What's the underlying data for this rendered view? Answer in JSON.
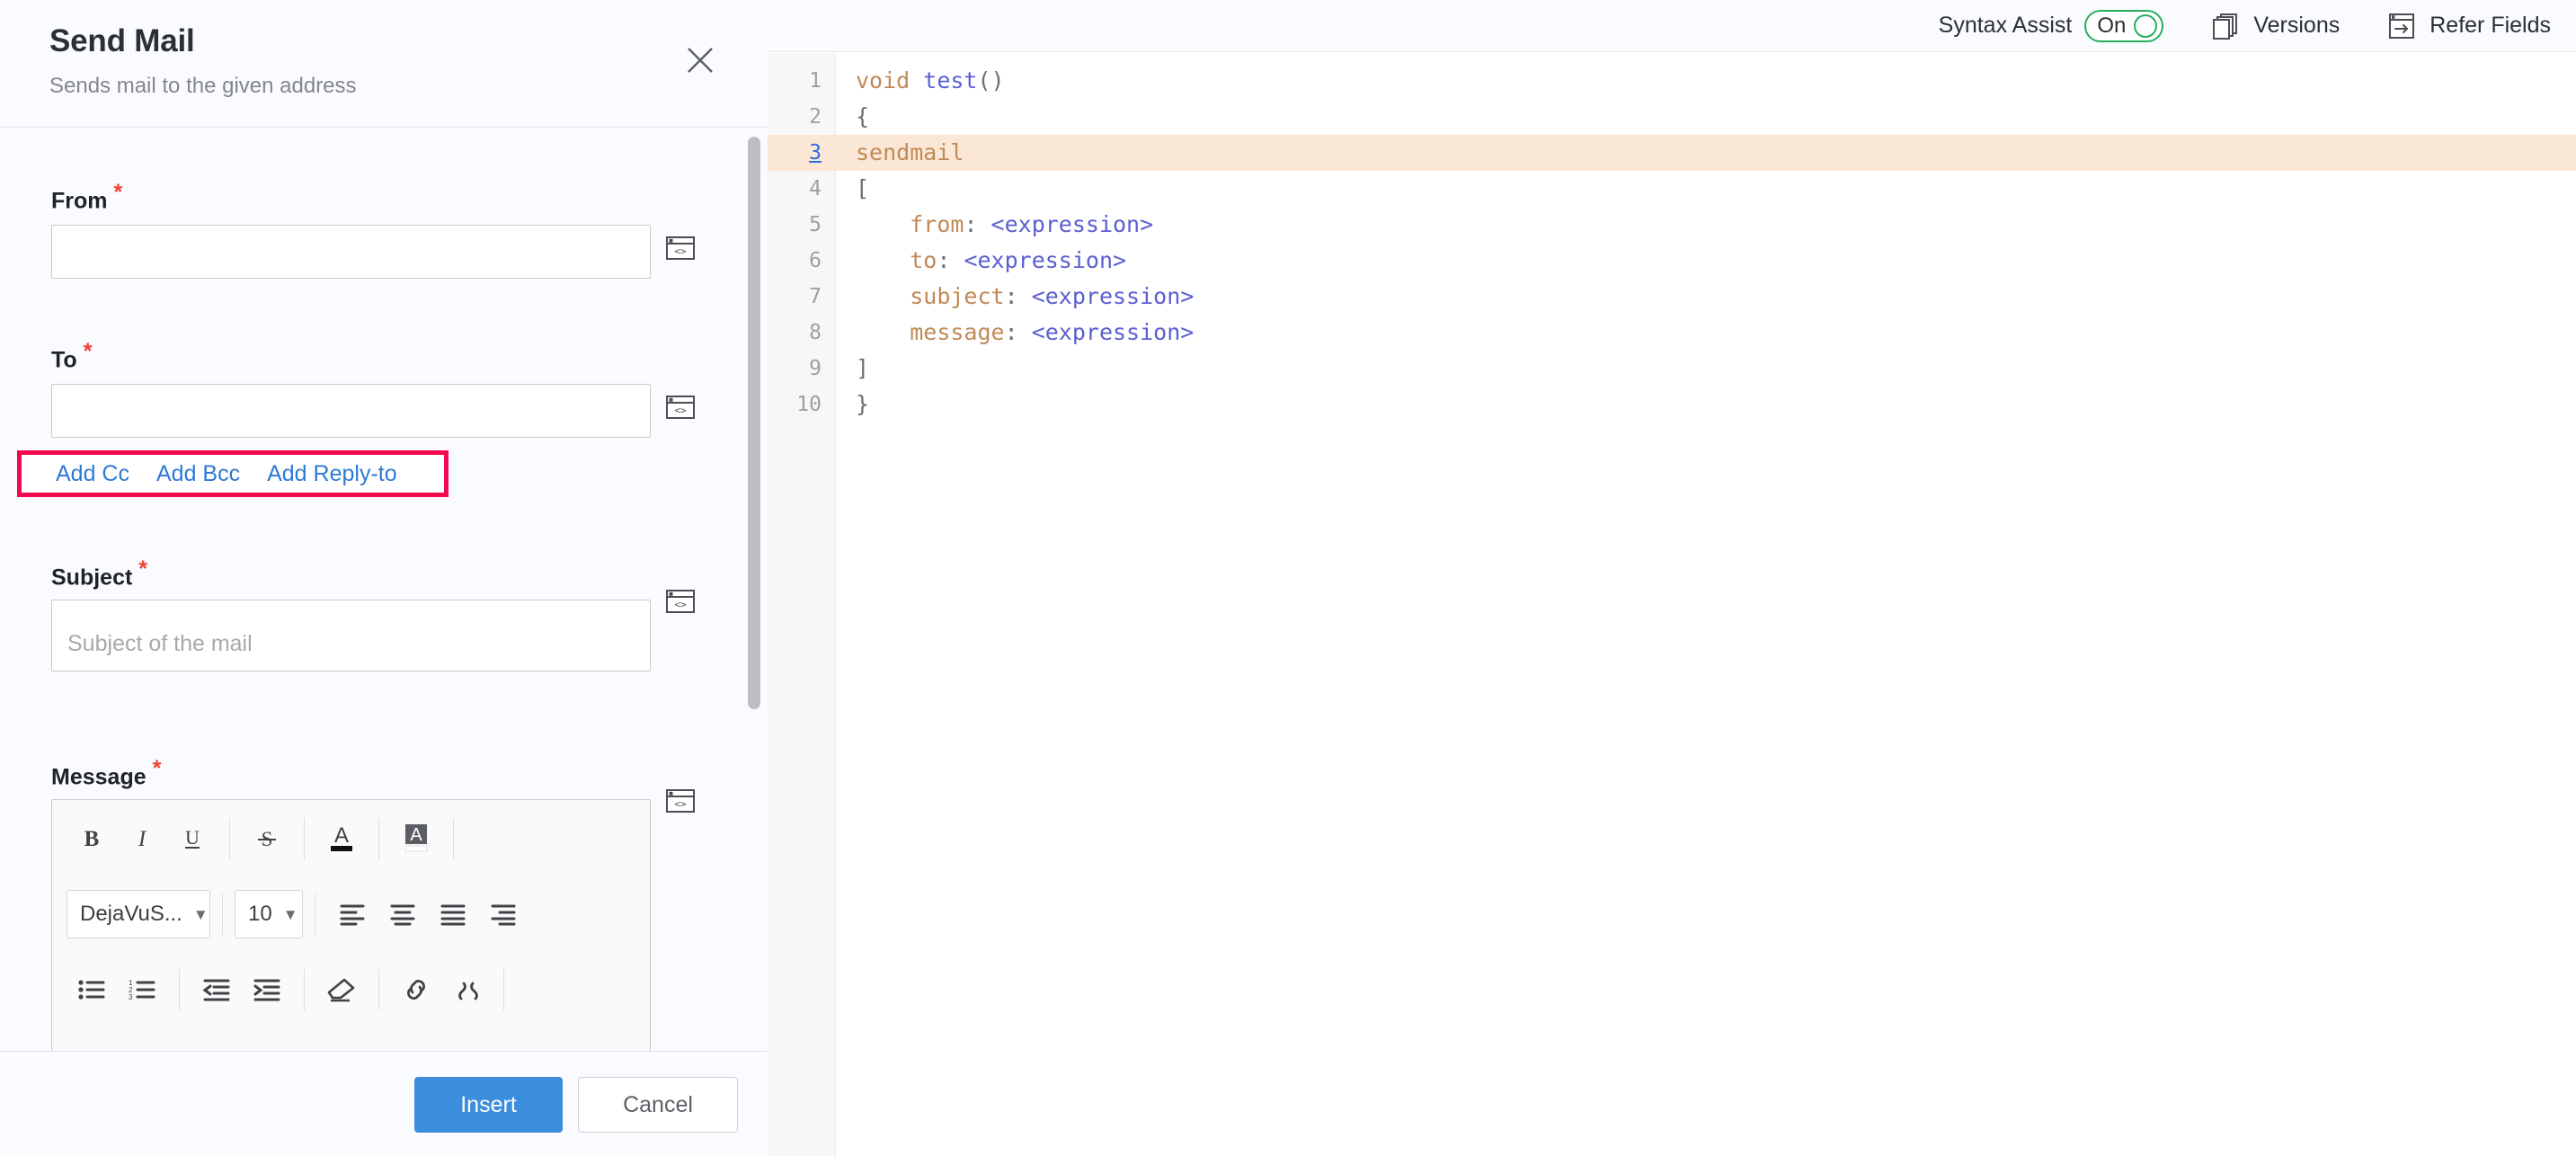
{
  "panel": {
    "title": "Send Mail",
    "subtitle": "Sends mail to the given address",
    "close_icon": "close-icon"
  },
  "form": {
    "required_mark": "*",
    "fields": [
      {
        "label": "From",
        "required": true,
        "value": "",
        "placeholder": ""
      },
      {
        "label": "To",
        "required": true,
        "value": "",
        "placeholder": ""
      },
      {
        "label": "Subject",
        "required": true,
        "value": "",
        "placeholder": "Subject of the mail"
      },
      {
        "label": "Message",
        "required": true,
        "value": "",
        "placeholder": ""
      }
    ],
    "recipient_links": [
      {
        "label": "Add Cc"
      },
      {
        "label": "Add Bcc"
      },
      {
        "label": "Add Reply-to"
      }
    ],
    "highlight_color": "#f3074f",
    "link_color": "#2e7ad4",
    "expression_icon": "expression-code-icon"
  },
  "editor_toolbar": {
    "row1": [
      {
        "name": "bold-icon",
        "label": "B"
      },
      {
        "name": "italic-icon",
        "label": "I"
      },
      {
        "name": "underline-icon",
        "label": "U"
      },
      {
        "name": "strikethrough-icon",
        "label": "S"
      },
      {
        "name": "font-color-icon",
        "label": "A"
      },
      {
        "name": "highlight-color-icon",
        "label": "A"
      }
    ],
    "font_family": "DejaVuS...",
    "font_size": "10",
    "row2": [
      {
        "name": "align-left-icon"
      },
      {
        "name": "align-center-icon"
      },
      {
        "name": "align-justify-icon"
      },
      {
        "name": "align-right-icon"
      }
    ],
    "row3": [
      {
        "name": "bullet-list-icon"
      },
      {
        "name": "numbered-list-icon"
      },
      {
        "name": "outdent-icon"
      },
      {
        "name": "indent-icon"
      },
      {
        "name": "clear-format-icon"
      },
      {
        "name": "insert-link-icon"
      },
      {
        "name": "remove-link-icon"
      }
    ]
  },
  "footer": {
    "insert_label": "Insert",
    "cancel_label": "Cancel",
    "primary_color": "#3c8ddc"
  },
  "toolbar": {
    "syntax_assist_label": "Syntax Assist",
    "syntax_assist_state": "On",
    "toggle_color": "#27ae60",
    "versions_label": "Versions",
    "versions_icon": "versions-stack-icon",
    "refer_fields_label": "Refer Fields",
    "refer_fields_icon": "refer-fields-arrow-icon"
  },
  "code": {
    "active_line": 3,
    "highlight_color": "#fbe7d5",
    "lines": [
      {
        "n": "1",
        "segments": [
          {
            "t": "void ",
            "c": "tok-kw"
          },
          {
            "t": "test",
            "c": "tok-fn"
          },
          {
            "t": "()",
            "c": "tok-punc"
          }
        ]
      },
      {
        "n": "2",
        "segments": [
          {
            "t": "{",
            "c": "tok-punc"
          }
        ]
      },
      {
        "n": "3",
        "segments": [
          {
            "t": "sendmail",
            "c": "tok-kw"
          }
        ]
      },
      {
        "n": "4",
        "segments": [
          {
            "t": "[",
            "c": "tok-punc"
          }
        ]
      },
      {
        "n": "5",
        "segments": [
          {
            "t": "    ",
            "c": "tok-punc"
          },
          {
            "t": "from",
            "c": "tok-prop"
          },
          {
            "t": ": ",
            "c": "tok-punc"
          },
          {
            "t": "<expression>",
            "c": "tok-expr"
          }
        ]
      },
      {
        "n": "6",
        "segments": [
          {
            "t": "    ",
            "c": "tok-punc"
          },
          {
            "t": "to",
            "c": "tok-prop"
          },
          {
            "t": ": ",
            "c": "tok-punc"
          },
          {
            "t": "<expression>",
            "c": "tok-expr"
          }
        ]
      },
      {
        "n": "7",
        "segments": [
          {
            "t": "    ",
            "c": "tok-punc"
          },
          {
            "t": "subject",
            "c": "tok-prop"
          },
          {
            "t": ": ",
            "c": "tok-punc"
          },
          {
            "t": "<expression>",
            "c": "tok-expr"
          }
        ]
      },
      {
        "n": "8",
        "segments": [
          {
            "t": "    ",
            "c": "tok-punc"
          },
          {
            "t": "message",
            "c": "tok-prop"
          },
          {
            "t": ": ",
            "c": "tok-punc"
          },
          {
            "t": "<expression>",
            "c": "tok-expr"
          }
        ]
      },
      {
        "n": "9",
        "segments": [
          {
            "t": "]",
            "c": "tok-punc"
          }
        ]
      },
      {
        "n": "10",
        "segments": [
          {
            "t": "}",
            "c": "tok-punc"
          }
        ]
      }
    ]
  }
}
